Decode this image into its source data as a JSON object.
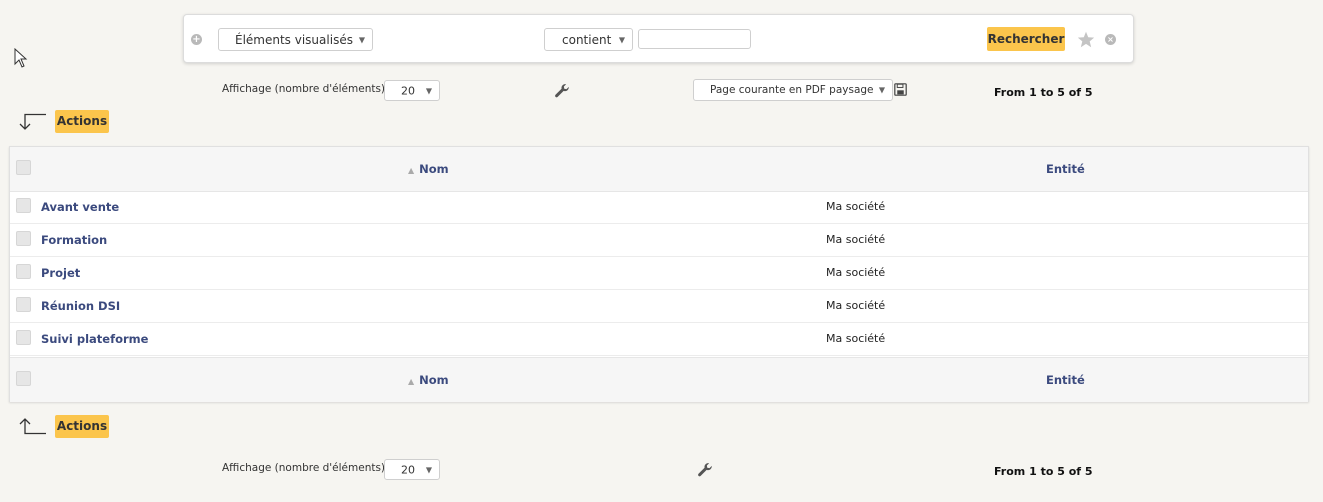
{
  "search": {
    "field_select": "Éléments visualisés",
    "operator_select": "contient",
    "value": "",
    "search_label": "Rechercher"
  },
  "top_toolbar": {
    "display_label": "Affichage (nombre d'éléments)",
    "page_size": "20",
    "export_select": "Page courante en PDF paysage",
    "pager": "From 1 to 5 of 5"
  },
  "actions_label": "Actions",
  "table": {
    "columns": [
      "Nom",
      "Entité"
    ],
    "rows": [
      {
        "nom": "Avant vente",
        "entite": "Ma société"
      },
      {
        "nom": "Formation",
        "entite": "Ma société"
      },
      {
        "nom": "Projet",
        "entite": "Ma société"
      },
      {
        "nom": "Réunion DSI",
        "entite": "Ma société"
      },
      {
        "nom": "Suivi plateforme",
        "entite": "Ma société"
      }
    ]
  },
  "bottom_toolbar": {
    "display_label": "Affichage (nombre d'éléments)",
    "page_size": "20",
    "pager": "From 1 to 5 of 5"
  }
}
